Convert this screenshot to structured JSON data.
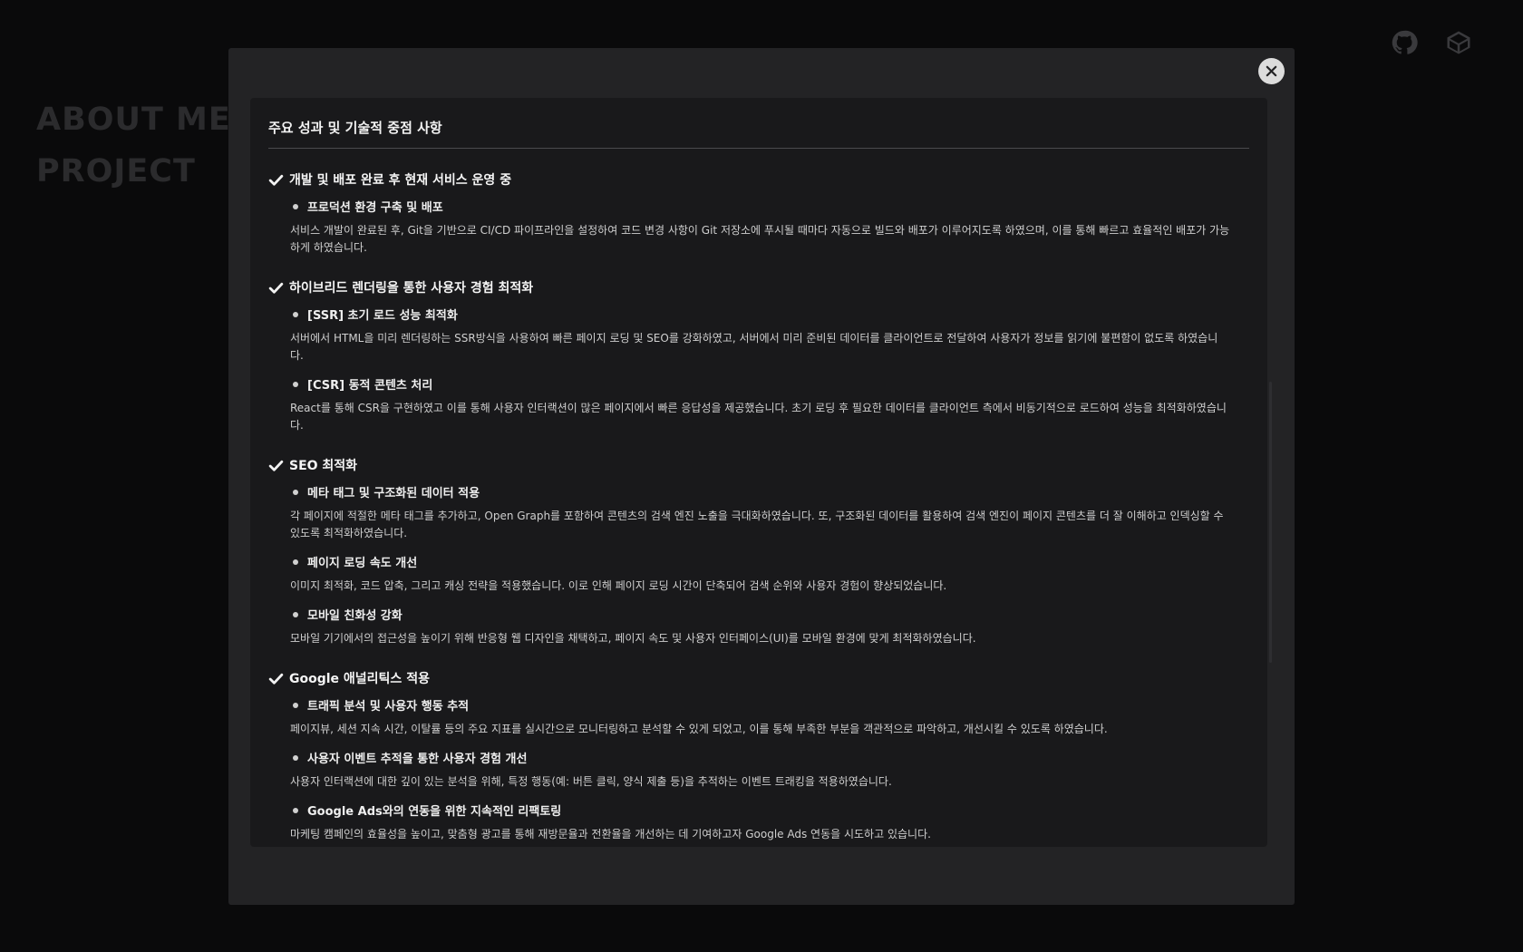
{
  "background": {
    "nav": [
      "ABOUT ME",
      "PROJECT"
    ]
  },
  "top_icons": [
    "github-icon",
    "velog-icon"
  ],
  "modal": {
    "close_icon": "close-icon",
    "panel_title": "주요 성과 및 기술적 중점 사항",
    "sections": [
      {
        "title": "개발 및 배포 완료 후 현재 서비스 운영 중",
        "items": [
          {
            "title": "프로덕션 환경 구축 및 배포",
            "desc": "서비스 개발이 완료된 후, Git을 기반으로 CI/CD 파이프라인을 설정하여 코드 변경 사항이 Git 저장소에 푸시될 때마다 자동으로 빌드와 배포가 이루어지도록 하였으며, 이를 통해 빠르고 효율적인 배포가 가능하게 하였습니다."
          }
        ]
      },
      {
        "title": "하이브리드 렌더링을 통한 사용자 경험 최적화",
        "items": [
          {
            "title": "[SSR] 초기 로드 성능 최적화",
            "desc": "서버에서 HTML을 미리 렌더링하는 SSR방식을 사용하여 빠른 페이지 로딩 및 SEO를 강화하였고, 서버에서 미리 준비된 데이터를 클라이언트로 전달하여 사용자가 정보를 읽기에 불편함이 없도록 하였습니다."
          },
          {
            "title": "[CSR] 동적 콘텐츠 처리",
            "desc": "React를 통해 CSR을 구현하였고 이를 통해 사용자 인터랙션이 많은 페이지에서 빠른 응답성을 제공했습니다. 초기 로딩 후 필요한 데이터를 클라이언트 측에서 비동기적으로 로드하여 성능을 최적화하였습니다."
          }
        ]
      },
      {
        "title": "SEO 최적화",
        "items": [
          {
            "title": "메타 태그 및 구조화된 데이터 적용",
            "desc": "각 페이지에 적절한 메타 태그를 추가하고, Open Graph를 포함하여 콘텐츠의 검색 엔진 노출을 극대화하였습니다. 또, 구조화된 데이터를 활용하여 검색 엔진이 페이지 콘텐츠를 더 잘 이해하고 인덱싱할 수 있도록 최적화하였습니다."
          },
          {
            "title": "페이지 로딩 속도 개선",
            "desc": "이미지 최적화, 코드 압축, 그리고 캐싱 전략을 적용했습니다. 이로 인해 페이지 로딩 시간이 단축되어 검색 순위와 사용자 경험이 향상되었습니다."
          },
          {
            "title": "모바일 친화성 강화",
            "desc": "모바일 기기에서의 접근성을 높이기 위해 반응형 웹 디자인을 채택하고, 페이지 속도 및 사용자 인터페이스(UI)를 모바일 환경에 맞게 최적화하였습니다."
          }
        ]
      },
      {
        "title": "Google 애널리틱스 적용",
        "items": [
          {
            "title": "트래픽 분석 및 사용자 행동 추적",
            "desc": "페이지뷰, 세션 지속 시간, 이탈률 등의 주요 지표를 실시간으로 모니터링하고 분석할 수 있게 되었고, 이를 통해 부족한 부분을 객관적으로 파악하고, 개선시킬 수 있도록 하였습니다."
          },
          {
            "title": "사용자 이벤트 추적을 통한 사용자 경험 개선",
            "desc": "사용자 인터랙션에 대한 깊이 있는 분석을 위해, 특정 행동(예: 버튼 클릭, 양식 제출 등)을 추적하는 이벤트 트래킹을 적용하였습니다."
          },
          {
            "title": "Google Ads와의 연동을 위한 지속적인 리팩토링",
            "desc": "마케팅 캠페인의 효율성을 높이고, 맞춤형 광고를 통해 재방문율과 전환율을 개선하는 데 기여하고자 Google Ads 연동을 시도하고 있습니다."
          }
        ]
      }
    ]
  }
}
